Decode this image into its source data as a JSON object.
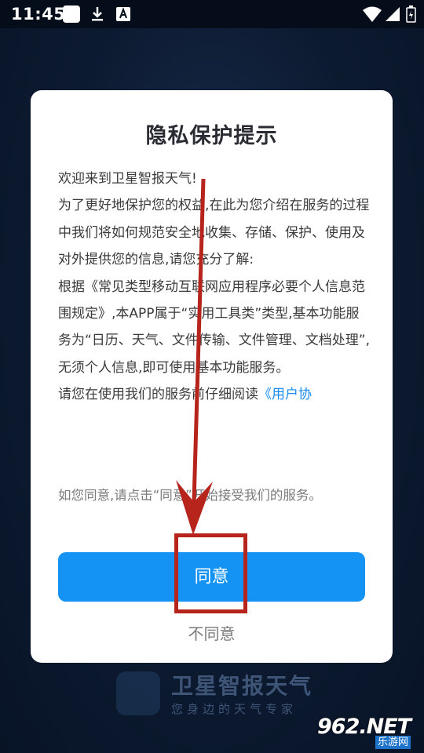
{
  "status_bar": {
    "time": "11:45",
    "icons": [
      "square-notification-icon",
      "download-icon",
      "a-notification-icon",
      "wifi-icon",
      "signal-icon",
      "battery-icon"
    ]
  },
  "dialog": {
    "title": "隐私保护提示",
    "paragraphs": [
      "欢迎来到卫星智报天气!",
      "为了更好地保护您的权益,在此为您介绍在服务的过程中我们将如何规范安全地收集、存储、保护、使用及对外提供您的信息,请您充分了解:",
      "根据《常见类型移动互联网应用程序必要个人信息范围规定》,本APP属于“实用工具类”类型,基本功能服务为“日历、天气、文件传输、文件管理、文档处理”,无须个人信息,即可使用基本功能服务。"
    ],
    "last_line_text": "请您在使用我们的服务前仔细阅读",
    "last_line_link": "《用户协",
    "agree_note": "如您同意,请点击“同意”开始接受我们的服务。",
    "agree_label": "同意",
    "disagree_label": "不同意"
  },
  "brand": {
    "name": "卫星智报天气",
    "slogan": "您身边的天气专家",
    "logo_text": "卫星"
  },
  "watermark": {
    "text": "962.NET",
    "sub": "乐游网"
  },
  "colors": {
    "accent": "#1593f5",
    "annotation": "#b6241c",
    "background": "#0c1a30"
  }
}
